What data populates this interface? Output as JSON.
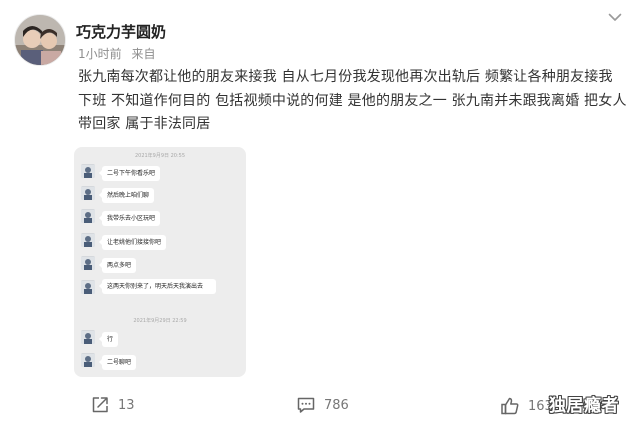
{
  "post": {
    "author": {
      "name": "巧克力芋圆奶",
      "avatar_icon": "user-avatar-photo"
    },
    "meta": {
      "time": "1小时前",
      "source_label": "来自"
    },
    "text_lines": [
      "张九南每次都让他的朋友来接我 自从七月份我发现他再次出轨后 频繁让各种朋友接我",
      "下班 不知道作何目的 包括视频中说的何建 是他的朋友之一 张九南并未跟我离婚 把女人",
      "带回家 属于非法同居"
    ],
    "menu_icon": "chevron-down-icon"
  },
  "chat": {
    "timestamps": [
      "2021年9月9日 20:55",
      "2021年9月29日 22:59"
    ],
    "messages": [
      "二号下午你看乐吧",
      "然后晚上咱们聊",
      "我带乐去小区玩吧",
      "让老姚他们接接你吧",
      "两点多吧",
      "这两天你别来了，明天后天我演出去",
      "行",
      "二号聊吧"
    ]
  },
  "actions": {
    "share": {
      "icon": "share-icon",
      "count": "13"
    },
    "comment": {
      "icon": "comment-icon",
      "count": "786"
    },
    "like": {
      "icon": "thumbs-up-icon",
      "count": "1632"
    }
  },
  "watermark": "独居瘾者",
  "colors": {
    "text": "#333333",
    "meta": "#8e8e8e",
    "card_bg": "#ededed",
    "bubble": "#ffffff"
  }
}
